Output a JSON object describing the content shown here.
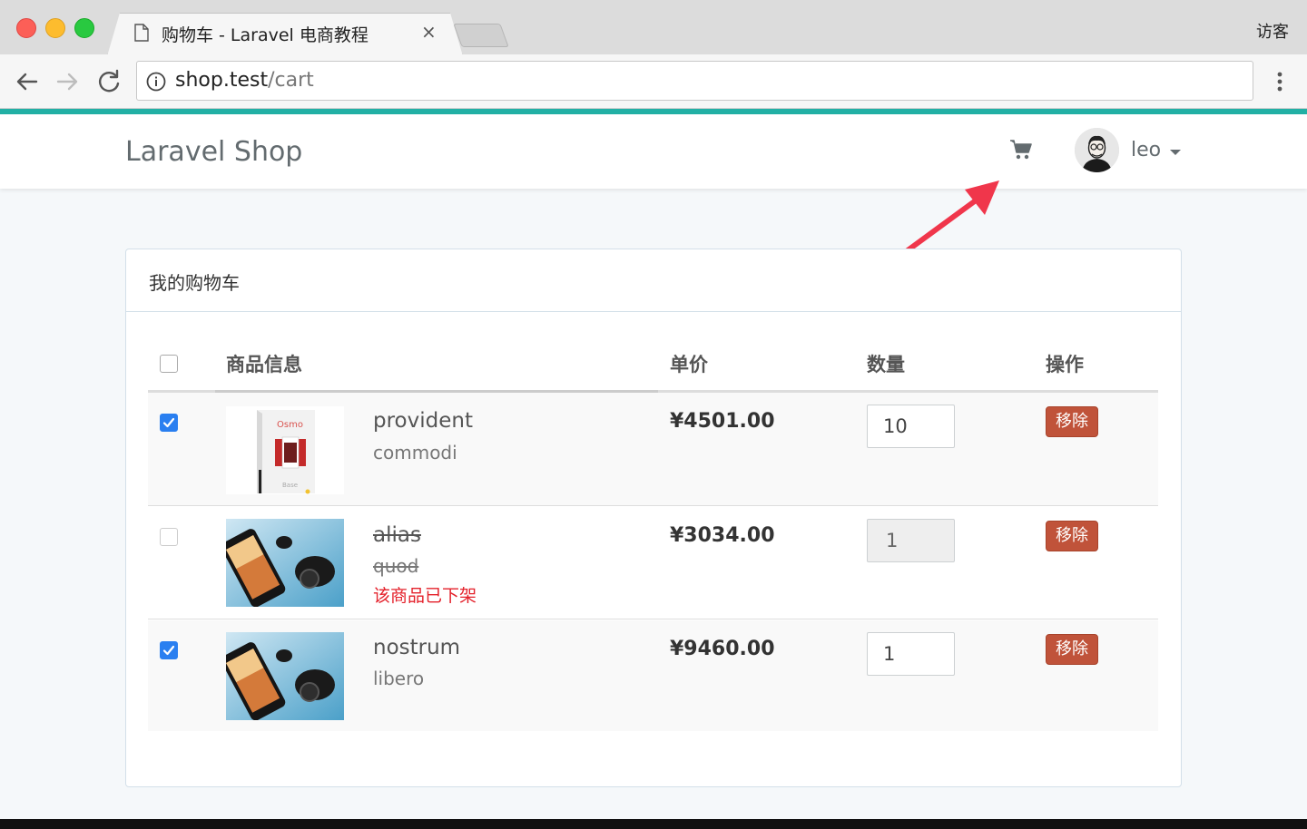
{
  "browser": {
    "tab_title": "购物车 - Laravel 电商教程",
    "tab_close": "×",
    "profile_label": "访客",
    "url_host": "shop.test",
    "url_path": "/cart"
  },
  "navbar": {
    "brand": "Laravel Shop",
    "username": "leo",
    "cart_icon": "shopping-cart-icon"
  },
  "cart": {
    "title": "我的购物车",
    "columns": {
      "product": "商品信息",
      "price": "单价",
      "quantity": "数量",
      "action": "操作"
    },
    "select_all_checked": false,
    "items": [
      {
        "title": "provident",
        "sku": "commodi",
        "price": "¥4501.00",
        "quantity": "10",
        "checked": true,
        "on_sale": true,
        "remove_label": "移除",
        "thumb_brand": "Osmo",
        "thumb_caption": "Base"
      },
      {
        "title": "alias",
        "sku": "quod",
        "price": "¥3034.00",
        "quantity": "1",
        "checked": false,
        "on_sale": false,
        "off_shelf_note": "该商品已下架",
        "remove_label": "移除"
      },
      {
        "title": "nostrum",
        "sku": "libero",
        "price": "¥9460.00",
        "quantity": "1",
        "checked": true,
        "on_sale": true,
        "remove_label": "移除"
      }
    ]
  },
  "colors": {
    "accent": "#22b0a5",
    "remove_button": "#c0533a",
    "checkbox_checked": "#2a7ff0",
    "off_shelf_text": "#e4212b",
    "annotation_arrow": "#f0364b"
  }
}
